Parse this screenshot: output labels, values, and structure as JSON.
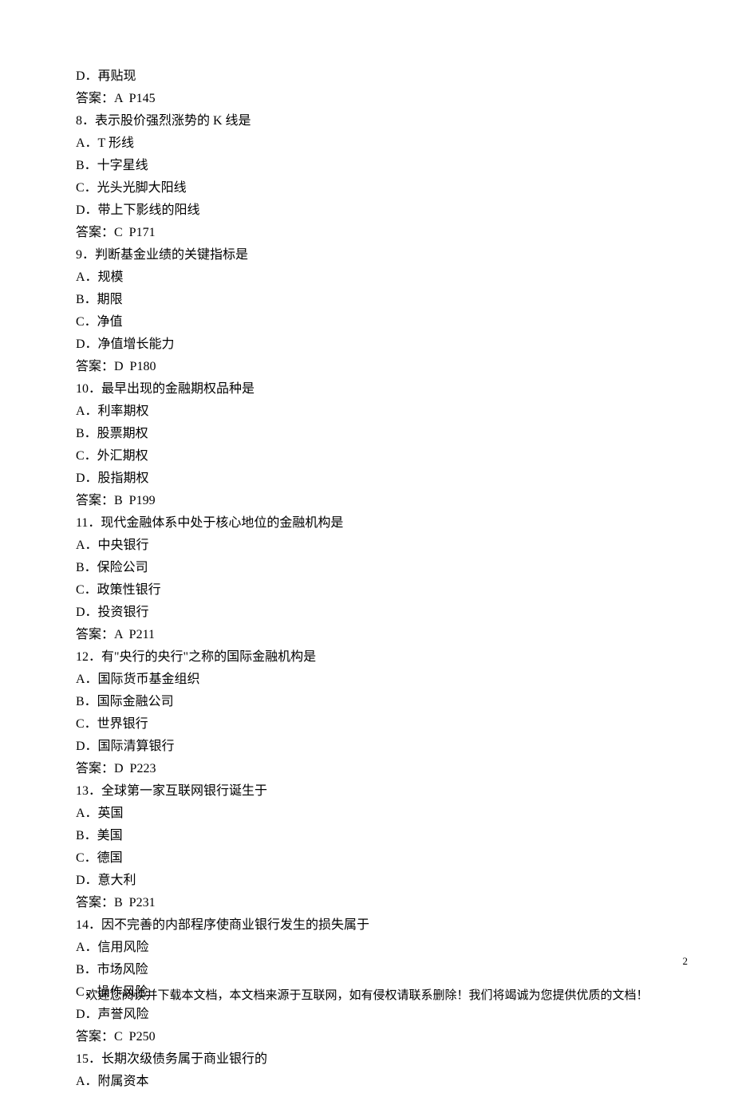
{
  "lines": {
    "l0": "D．再贴现",
    "l1": "答案：A  P145",
    "l2": "8．表示股价强烈涨势的 K 线是",
    "l3": "A．T 形线",
    "l4": "B．十字星线",
    "l5": "C．光头光脚大阳线",
    "l6": "D．带上下影线的阳线",
    "l7": "答案：C  P171",
    "l8": "9．判断基金业绩的关键指标是",
    "l9": "A．规模",
    "l10": "B．期限",
    "l11": "C．净值",
    "l12": "D．净值增长能力",
    "l13": "答案：D  P180",
    "l14": "10．最早出现的金融期权品种是",
    "l15": "A．利率期权",
    "l16": "B．股票期权",
    "l17": "C．外汇期权",
    "l18": "D．股指期权",
    "l19": "答案：B  P199",
    "l20": "11．现代金融体系中处于核心地位的金融机构是",
    "l21": "A．中央银行",
    "l22": "B．保险公司",
    "l23": "C．政策性银行",
    "l24": "D．投资银行",
    "l25": "答案：A  P211",
    "l26": "12．有\"央行的央行\"之称的国际金融机构是",
    "l27": "A．国际货币基金组织",
    "l28": "B．国际金融公司",
    "l29": "C．世界银行",
    "l30": "D．国际清算银行",
    "l31": "答案：D  P223",
    "l32": "13．全球第一家互联网银行诞生于",
    "l33": "A．英国",
    "l34": "B．美国",
    "l35": "C．德国",
    "l36": "D．意大利",
    "l37": "答案：B  P231",
    "l38": "14．因不完善的内部程序使商业银行发生的损失属于",
    "l39": "A．信用风险",
    "l40": "B．市场风险",
    "l41": "C．操作风险",
    "l42": "D．声誉风险",
    "l43": "答案：C  P250",
    "l44": "15．长期次级债务属于商业银行的",
    "l45": "A．附属资本"
  },
  "page_number": "2",
  "footer_text": "欢迎您阅读并下载本文档，本文档来源于互联网，如有侵权请联系删除！我们将竭诚为您提供优质的文档！"
}
